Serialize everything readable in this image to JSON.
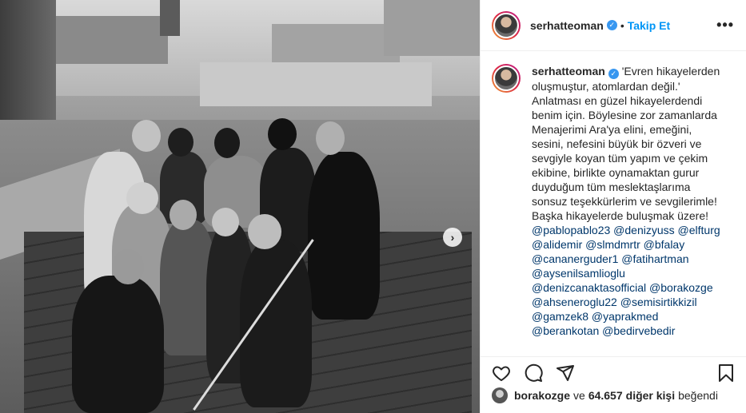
{
  "photo": {
    "description_icon": "carousel-next-icon",
    "next_glyph": "›"
  },
  "header": {
    "username": "serhatteoman",
    "separator": "•",
    "follow_label": "Takip Et",
    "more_glyph": "•••"
  },
  "caption": {
    "username": "serhatteoman",
    "lines": [
      "'Evren hikayelerden",
      "oluşmuştur, atomlardan değil.'",
      "Anlatması en güzel hikayelerdendi",
      "benim için. Böylesine zor zamanlarda",
      "Menajerimi Ara'ya elini, emeğini,",
      "sesini, nefesini büyük bir özveri ve",
      "sevgiyle koyan tüm yapım ve çekim",
      "ekibine, birlikte oynamaktan gurur",
      "duyduğum tüm meslektaşlarıma",
      "sonsuz teşekkürlerim ve sevgilerimle!",
      "Başka hikayelerde buluşmak üzere!"
    ],
    "mention_lines": [
      "@pablopablo23 @denizyuss @elfturg",
      "@alidemir @slmdmrtr @bfalay",
      "@cananerguder1 @fatihartman",
      "@aysenilsamlioglu",
      "@denizcanaktasofficial @borakozge",
      "@ahseneroglu22 @semisirtikkizil",
      "@gamzek8 @yaprakmed",
      "@berankotan @bedirvebedir"
    ]
  },
  "likes": {
    "user": "borakozge",
    "connector": "ve",
    "count": "64.657",
    "others": "diğer kişi",
    "suffix": "beğendi"
  },
  "colors": {
    "accent": "#0095f6",
    "verified": "#3897f0",
    "mention": "#00376b",
    "text": "#262626"
  }
}
